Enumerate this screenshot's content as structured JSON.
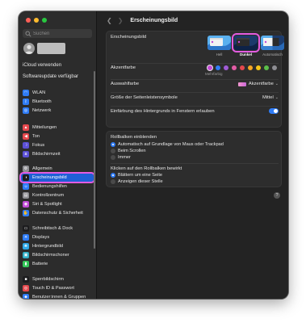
{
  "search": {
    "placeholder": "Suchen"
  },
  "sidebar": {
    "links": [
      "iCloud verwenden",
      "Softwareupdate verfügbar"
    ],
    "items": [
      {
        "label": "WLAN",
        "icon": "wifi-icon",
        "color": "#2f7cf6"
      },
      {
        "label": "Bluetooth",
        "icon": "bluetooth-icon",
        "color": "#2f7cf6"
      },
      {
        "label": "Netzwerk",
        "icon": "globe-icon",
        "color": "#2f7cf6"
      },
      {
        "label": "Mitteilungen",
        "icon": "bell-icon",
        "color": "#e5484d"
      },
      {
        "label": "Ton",
        "icon": "speaker-icon",
        "color": "#e5484d"
      },
      {
        "label": "Fokus",
        "icon": "moon-icon",
        "color": "#5b50d6"
      },
      {
        "label": "Bildschirmzeit",
        "icon": "hourglass-icon",
        "color": "#5b50d6"
      },
      {
        "label": "Allgemein",
        "icon": "gear-icon",
        "color": "#8e8e93"
      },
      {
        "label": "Erscheinungsbild",
        "icon": "appearance-icon",
        "color": "#1c1c1e"
      },
      {
        "label": "Bedienungshilfen",
        "icon": "accessibility-icon",
        "color": "#2f7cf6"
      },
      {
        "label": "Kontrollzentrum",
        "icon": "control-center-icon",
        "color": "#8e8e93"
      },
      {
        "label": "Siri & Spotlight",
        "icon": "siri-icon",
        "color": "#c24bd8"
      },
      {
        "label": "Datenschutz & Sicherheit",
        "icon": "hand-icon",
        "color": "#2f7cf6"
      },
      {
        "label": "Schreibtisch & Dock",
        "icon": "dock-icon",
        "color": "#1c1c1e"
      },
      {
        "label": "Displays",
        "icon": "display-icon",
        "color": "#2f7cf6"
      },
      {
        "label": "Hintergrundbild",
        "icon": "wallpaper-icon",
        "color": "#2fa9e8"
      },
      {
        "label": "Bildschirmschoner",
        "icon": "screensaver-icon",
        "color": "#30b0c7"
      },
      {
        "label": "Batterie",
        "icon": "battery-icon",
        "color": "#34c759"
      },
      {
        "label": "Sperrbildschirm",
        "icon": "lock-icon",
        "color": "#1c1c1e"
      },
      {
        "label": "Touch ID & Passwort",
        "icon": "fingerprint-icon",
        "color": "#e5484d"
      },
      {
        "label": "Benutzer:innen & Gruppen",
        "icon": "users-icon",
        "color": "#2f7cf6"
      }
    ],
    "active_index": 8
  },
  "header": {
    "title": "Erscheinungsbild"
  },
  "appearance": {
    "label": "Erscheinungsbild",
    "options": [
      {
        "label": "Hell"
      },
      {
        "label": "Dunkel"
      },
      {
        "label": "Automatisch"
      }
    ],
    "selected": "Dunkel"
  },
  "accent": {
    "label": "Akzentfarbe",
    "caption": "Mehrfarbig",
    "colors": [
      "#c44bd6",
      "#2f7cf6",
      "#a05bd6",
      "#e35ca5",
      "#e5484d",
      "#f5a524",
      "#f5c518",
      "#5bbf4a",
      "#8e8e93"
    ]
  },
  "highlight": {
    "label": "Auswahlfarbe",
    "value": "Akzentfarbe"
  },
  "sidebar_icon_size": {
    "label": "Größe der Seitenleistensymbole",
    "value": "Mittel"
  },
  "wallpaper_tint": {
    "label": "Einfärbung des Hintergrunds in Fenstern erlauben"
  },
  "scrollbars": {
    "label": "Rollbalken einblenden",
    "options": [
      "Automatisch auf Grundlage von Maus oder Trackpad",
      "Beim Scrollen",
      "Immer"
    ]
  },
  "click_scroll": {
    "label": "Klicken auf den Rollbalken bewirkt",
    "options": [
      "Blättern um eine Seite",
      "Anzeigen dieser Stelle"
    ]
  },
  "help": {
    "label": "?"
  }
}
